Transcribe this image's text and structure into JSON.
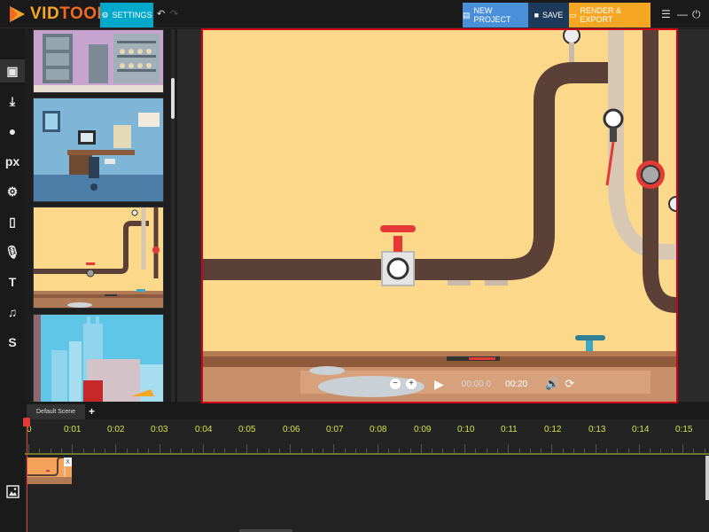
{
  "app": {
    "logo_vid": "VID",
    "logo_toon": "TOON"
  },
  "toolbar": {
    "settings_label": "SETTINGS",
    "new_project_label": "NEW PROJECT",
    "save_label": "SAVE",
    "render_label": "RENDER & EXPORT"
  },
  "left_tools": [
    {
      "name": "backgrounds-icon",
      "glyph": "▣"
    },
    {
      "name": "import-icon",
      "glyph": "⤓"
    },
    {
      "name": "characters-icon",
      "glyph": "●"
    },
    {
      "name": "pixabay-icon",
      "glyph": "px"
    },
    {
      "name": "props-icon",
      "glyph": "⚙"
    },
    {
      "name": "document-icon",
      "glyph": "▯"
    },
    {
      "name": "microphone-icon",
      "glyph": "🎙"
    },
    {
      "name": "text-icon",
      "glyph": "T"
    },
    {
      "name": "music-icon",
      "glyph": "♫"
    },
    {
      "name": "dollar-icon",
      "glyph": "S"
    }
  ],
  "playback": {
    "current_time": "00:00.0",
    "end_time": "00:20"
  },
  "timeline": {
    "scene_tab": "Default Scene",
    "ticks": [
      "0",
      "0:01",
      "0:02",
      "0:03",
      "0:04",
      "0:05",
      "0:06",
      "0:07",
      "0:08",
      "0:09",
      "0:10",
      "0:11",
      "0:12",
      "0:13",
      "0:14",
      "0:15"
    ],
    "clip_close": "X"
  },
  "colors": {
    "settings_bg": "#00a8cc",
    "new_project_bg": "#4a90d9",
    "save_bg": "#1e3a5a",
    "render_bg": "#f5a623",
    "stage_border": "#d0021b",
    "tick_color": "#d6e24a"
  }
}
